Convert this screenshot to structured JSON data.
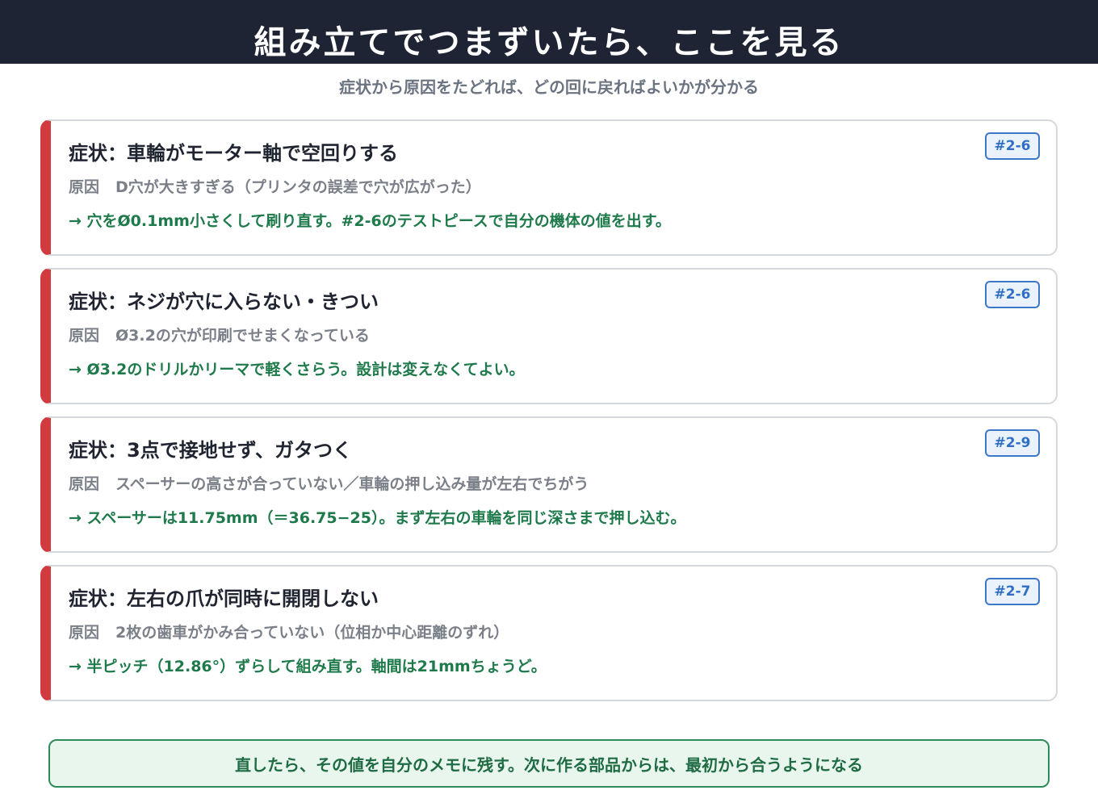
{
  "header": {
    "title": "組み立てでつまずいたら、ここを見る",
    "subtitle": "症状から原因をたどれば、どの回に戻ればよいかが分かる"
  },
  "cards": [
    {
      "symptom": "症状：車輪がモーター軸で空回りする",
      "cause_label": "原因",
      "cause": "D穴が大きすぎる（プリンタの誤差で穴が広がった）",
      "fix": "→ 穴をØ0.1mm小さくして刷り直す。#2-6のテストピースで自分の機体の値を出す。",
      "badge": "#2-6"
    },
    {
      "symptom": "症状：ネジが穴に入らない・きつい",
      "cause_label": "原因",
      "cause": "Ø3.2の穴が印刷でせまくなっている",
      "fix": "→ Ø3.2のドリルかリーマで軽くさらう。設計は変えなくてよい。",
      "badge": "#2-6"
    },
    {
      "symptom": "症状：3点で接地せず、ガタつく",
      "cause_label": "原因",
      "cause": "スペーサーの高さが合っていない／車輪の押し込み量が左右でちがう",
      "fix": "→ スペーサーは11.75mm（＝36.75−25）。まず左右の車輪を同じ深さまで押し込む。",
      "badge": "#2-9"
    },
    {
      "symptom": "症状：左右の爪が同時に開閉しない",
      "cause_label": "原因",
      "cause": "2枚の歯車がかみ合っていない（位相か中心距離のずれ）",
      "fix": "→ 半ピッチ（12.86°）ずらして組み直す。軸間は21mmちょうど。",
      "badge": "#2-7"
    }
  ],
  "footer": {
    "note": "直したら、その値を自分のメモに残す。次に作る部品からは、最初から合うようになる"
  },
  "colors": {
    "header_bg": "#1e2433",
    "accent_red": "#d13a3f",
    "fix_green": "#1f7a4b",
    "badge_blue": "#2f6fc4"
  }
}
